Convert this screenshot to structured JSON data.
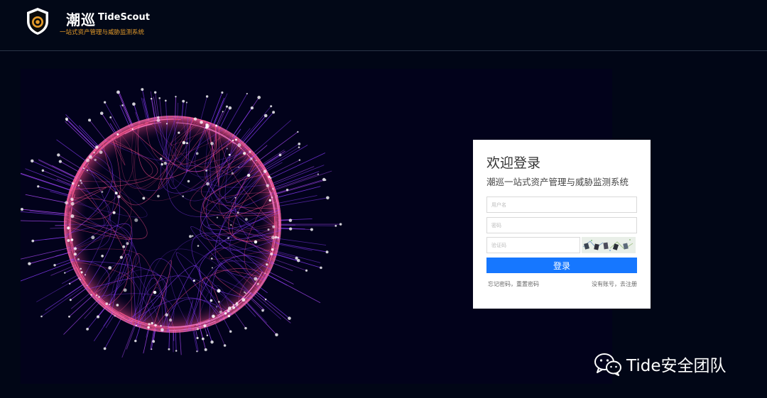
{
  "header": {
    "brand_cn": "潮巡",
    "brand_en": "TideScout",
    "brand_sub": "一站式资产管理与威胁监测系统"
  },
  "login": {
    "welcome": "欢迎登录",
    "system_title": "潮巡一站式资产管理与威胁监测系统",
    "username_placeholder": "用户名",
    "password_placeholder": "密码",
    "captcha_placeholder": "验证码",
    "submit_label": "登录",
    "forgot_link": "忘记密码，重置密码",
    "register_link": "没有账号，去注册"
  },
  "watermark": {
    "text": "Tide安全团队"
  },
  "colors": {
    "background": "#010616",
    "brand_accent": "#e39a2a",
    "primary_button": "#1677ff",
    "globe_pink": "#ff4d8d",
    "globe_purple": "#8a3cff"
  },
  "icons": {
    "logo": "shield-eye-icon",
    "watermark": "wechat-icon"
  }
}
